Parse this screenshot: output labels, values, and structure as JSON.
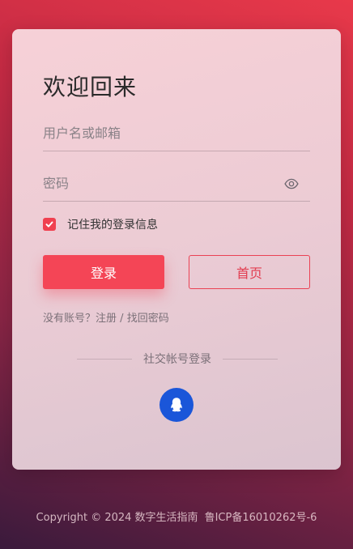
{
  "login": {
    "title": "欢迎回来",
    "username_placeholder": "用户名或邮箱",
    "password_placeholder": "密码",
    "remember_label": "记住我的登录信息",
    "remember_checked": true,
    "login_button": "登录",
    "home_button": "首页",
    "links_prefix": "没有账号？",
    "register_link": "注册",
    "links_separator": " / ",
    "forgot_link": "找回密码",
    "social_divider": "社交帐号登录"
  },
  "icons": {
    "password_toggle": "eye-icon",
    "checkbox": "check-icon",
    "social": "qq-icon"
  },
  "colors": {
    "accent": "#f44556",
    "qq": "#1a56d9"
  },
  "footer": {
    "copyright": "Copyright © 2024 数字生活指南",
    "icp": "鲁ICP备16010262号-6"
  }
}
